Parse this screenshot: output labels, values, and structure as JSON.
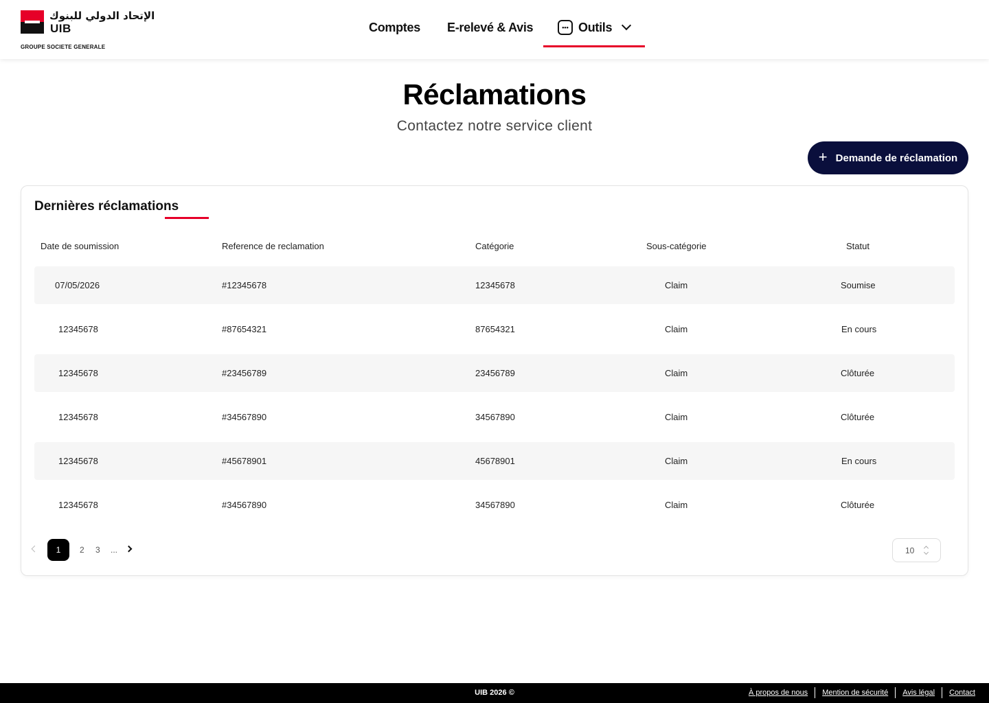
{
  "header": {
    "logo_arabic": "الإتحاد الدولي للبنوك",
    "logo_uib": "UIB",
    "logo_group": "GROUPE SOCIETE GENERALE",
    "nav": {
      "comptes": "Comptes",
      "ereleve": "E-relevé & Avis",
      "outils": "Outils"
    },
    "active_nav": "Outils",
    "accent_color": "#e60028"
  },
  "page": {
    "title": "Réclamations",
    "subtitle": "Contactez notre service client",
    "cta_label": "Demande de réclamation",
    "cta_color": "#0a0f3c"
  },
  "card": {
    "title": "Dernières réclamations",
    "columns": {
      "date": "Date de soumission",
      "ref": "Reference de reclamation",
      "cat": "Catégorie",
      "sub": "Sous-catégorie",
      "stat": "Statut"
    },
    "rows": [
      {
        "date": "07/05/2026",
        "ref": "#12345678",
        "cat": "12345678",
        "sub": "Claim",
        "stat": "Soumise"
      },
      {
        "date": "12345678",
        "ref": "#87654321",
        "cat": "87654321",
        "sub": "Claim",
        "stat": "En cours"
      },
      {
        "date": "12345678",
        "ref": "#23456789",
        "cat": "23456789",
        "sub": "Claim",
        "stat": "Clôturée"
      },
      {
        "date": "12345678",
        "ref": "#34567890",
        "cat": "34567890",
        "sub": "Claim",
        "stat": "Clôturée"
      },
      {
        "date": "12345678",
        "ref": "#45678901",
        "cat": "45678901",
        "sub": "Claim",
        "stat": "En cours"
      },
      {
        "date": "12345678",
        "ref": "#34567890",
        "cat": "34567890",
        "sub": "Claim",
        "stat": "Clôturée"
      }
    ],
    "pagination": {
      "current": "1",
      "pages": [
        "2",
        "3"
      ],
      "ellipsis": "...",
      "per_page": "10"
    }
  },
  "footer": {
    "copyright": "UIB 2026 ©",
    "links": [
      "À propos de nous",
      "Mention de sécurité",
      "Avis légal",
      "Contact"
    ]
  }
}
